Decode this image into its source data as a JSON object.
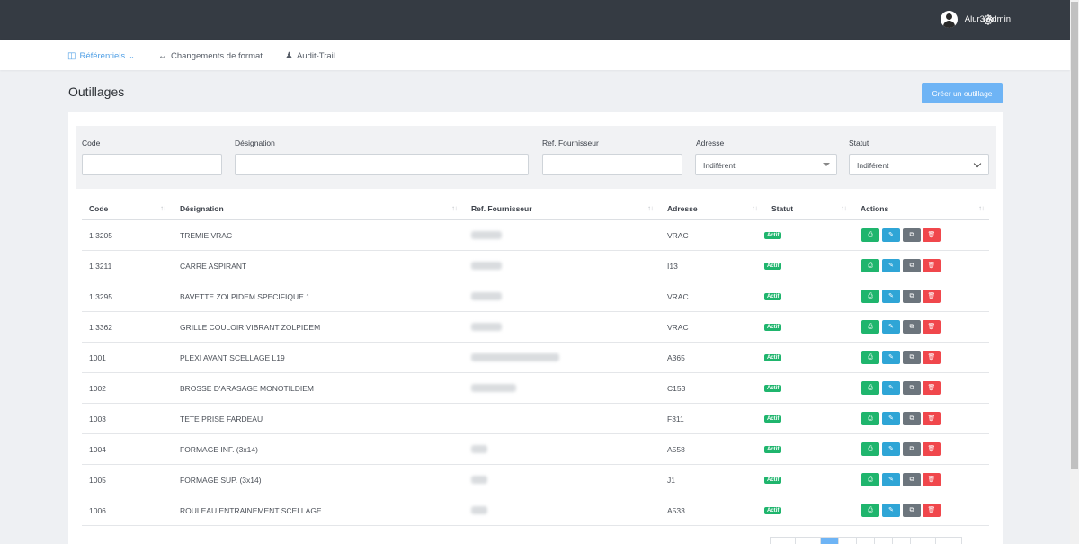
{
  "header": {
    "user_name": "Alur3 Admin",
    "settings_icon": "gear-icon"
  },
  "nav": {
    "items": [
      {
        "label": "Référentiels",
        "icon": "database-icon",
        "active": true
      },
      {
        "label": "Changements de format",
        "icon": "arrows-horizontal-icon"
      },
      {
        "label": "Audit-Trail",
        "icon": "users-icon"
      }
    ]
  },
  "page": {
    "title": "Outillages",
    "create_button": "Créer un outillage"
  },
  "filters": {
    "code_label": "Code",
    "designation_label": "Désignation",
    "ref_label": "Ref. Fournisseur",
    "adresse_label": "Adresse",
    "adresse_value": "Indiférent",
    "statut_label": "Statut",
    "statut_value": "Indiférent"
  },
  "table": {
    "columns": [
      "Code",
      "Désignation",
      "Ref. Fournisseur",
      "Adresse",
      "Statut",
      "Actions"
    ],
    "rows": [
      {
        "code": "1 3205",
        "designation": "TREMIE VRAC",
        "adresse": "VRAC",
        "statut": "Actif"
      },
      {
        "code": "1 3211",
        "designation": "CARRE ASPIRANT",
        "adresse": "I13",
        "statut": "Actif"
      },
      {
        "code": "1 3295",
        "designation": "BAVETTE ZOLPIDEM SPECIFIQUE 1",
        "adresse": "VRAC",
        "statut": "Actif"
      },
      {
        "code": "1 3362",
        "designation": "GRILLE COULOIR VIBRANT ZOLPIDEM",
        "adresse": "VRAC",
        "statut": "Actif"
      },
      {
        "code": "1001",
        "designation": "PLEXI AVANT SCELLAGE L19",
        "adresse": "A365",
        "statut": "Actif"
      },
      {
        "code": "1002",
        "designation": "BROSSE D'ARASAGE MONOTILDIEM",
        "adresse": "C153",
        "statut": "Actif"
      },
      {
        "code": "1003",
        "designation": "TETE PRISE FARDEAU",
        "adresse": "F311",
        "statut": "Actif"
      },
      {
        "code": "1004",
        "designation": "FORMAGE INF. (3x14)",
        "adresse": "A558",
        "statut": "Actif"
      },
      {
        "code": "1005",
        "designation": "FORMAGE SUP. (3x14)",
        "adresse": "J1",
        "statut": "Actif"
      },
      {
        "code": "1006",
        "designation": "ROULEAU ENTRAINEMENT SCELLAGE",
        "adresse": "A533",
        "statut": "Actif"
      }
    ],
    "action_icons": [
      "print-icon",
      "edit-icon",
      "copy-icon",
      "trash-icon"
    ]
  },
  "colors": {
    "topbar": "#353b43",
    "accent": "#6eb4f5",
    "status_active": "#1fb56d",
    "danger": "#f0474c"
  }
}
